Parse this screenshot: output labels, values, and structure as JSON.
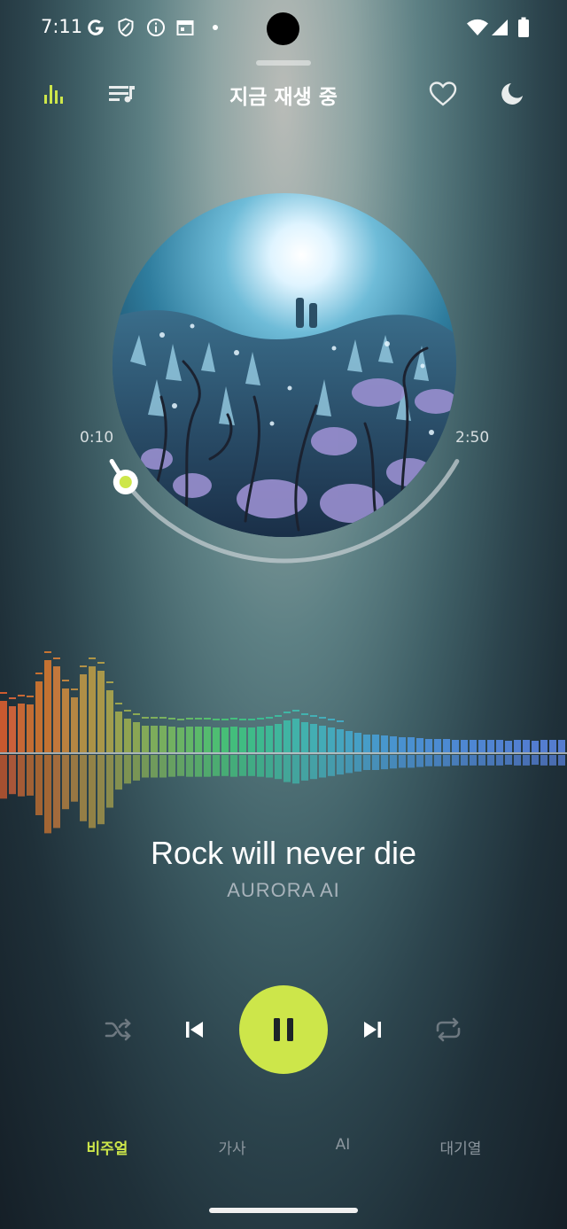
{
  "status_bar": {
    "time": "7:11",
    "left_icons": [
      "google-icon",
      "shield-icon",
      "info-icon",
      "calendar-icon",
      "dot-icon"
    ],
    "right_icons": [
      "wifi-icon",
      "signal-icon",
      "battery-icon"
    ]
  },
  "header": {
    "title": "지금 재생 중",
    "left_icons": [
      "equalizer-icon",
      "playlist-icon"
    ],
    "right_icons": [
      "heart-icon",
      "moon-icon"
    ],
    "accent_color": "#cde64a"
  },
  "player": {
    "elapsed": "0:10",
    "total": "2:50",
    "progress_fraction": 0.06
  },
  "song": {
    "title": "Rock will never die",
    "artist": "AURORA AI"
  },
  "controls": {
    "icons": [
      "shuffle-icon",
      "previous-icon",
      "pause-icon",
      "next-icon",
      "repeat-icon"
    ],
    "state": "playing"
  },
  "tabs": [
    {
      "label": "비주얼",
      "active": true
    },
    {
      "label": "가사",
      "active": false
    },
    {
      "label": "AI",
      "active": false
    },
    {
      "label": "대기열",
      "active": false
    }
  ]
}
